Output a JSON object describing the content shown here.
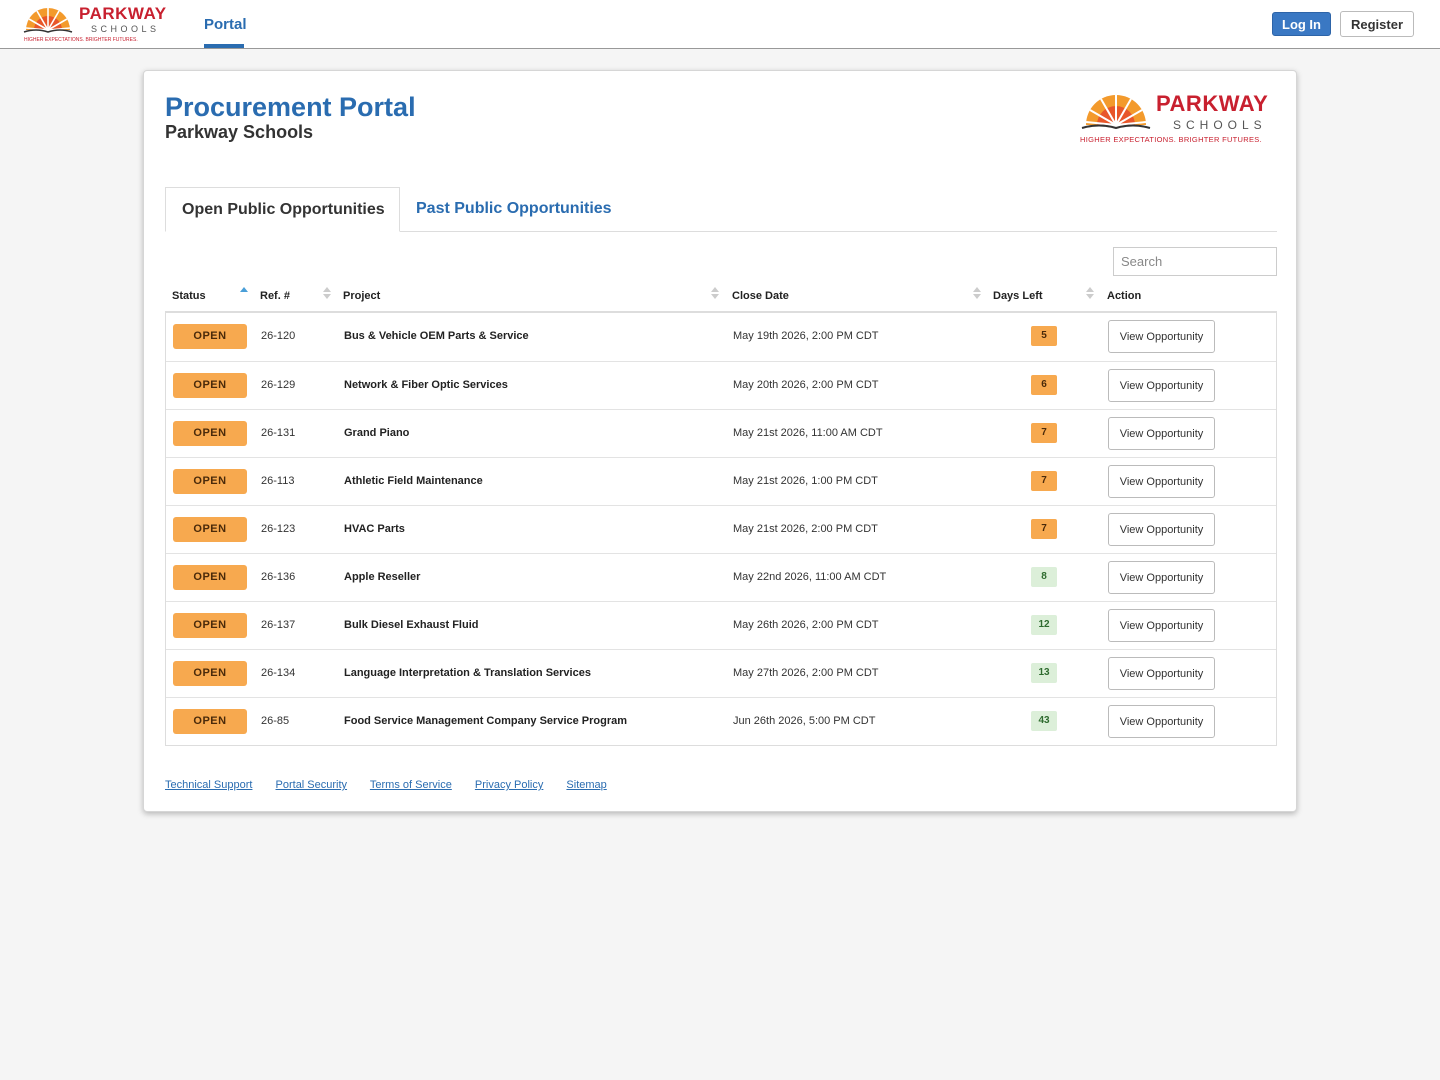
{
  "brand": {
    "name": "PARKWAY",
    "sub": "SCHOOLS",
    "tagline": "HIGHER EXPECTATIONS. BRIGHTER FUTURES.",
    "accent_red": "#c8202f",
    "accent_orange": "#f39a2c"
  },
  "navbar": {
    "portal_label": "Portal",
    "login_label": "Log In",
    "register_label": "Register"
  },
  "header": {
    "title": "Procurement Portal",
    "subtitle": "Parkway Schools"
  },
  "tabs": [
    {
      "label": "Open Public Opportunities",
      "active": true
    },
    {
      "label": "Past Public Opportunities",
      "active": false
    }
  ],
  "search": {
    "placeholder": "Search",
    "value": ""
  },
  "table": {
    "columns": [
      "Status",
      "Ref. #",
      "Project",
      "Close Date",
      "Days Left",
      "Action"
    ],
    "sorted_column": "Status",
    "rows": [
      {
        "status": "OPEN",
        "ref": "26-120",
        "project": "Bus & Vehicle OEM Parts & Service",
        "close_date": "May 19th 2026, 2:00 PM CDT",
        "days_left": "5",
        "days_level": "warn",
        "action": "View Opportunity"
      },
      {
        "status": "OPEN",
        "ref": "26-129",
        "project": "Network & Fiber Optic Services",
        "close_date": "May 20th 2026, 2:00 PM CDT",
        "days_left": "6",
        "days_level": "warn",
        "action": "View Opportunity"
      },
      {
        "status": "OPEN",
        "ref": "26-131",
        "project": "Grand Piano",
        "close_date": "May 21st 2026, 11:00 AM CDT",
        "days_left": "7",
        "days_level": "warn",
        "action": "View Opportunity"
      },
      {
        "status": "OPEN",
        "ref": "26-113",
        "project": "Athletic Field Maintenance",
        "close_date": "May 21st 2026, 1:00 PM CDT",
        "days_left": "7",
        "days_level": "warn",
        "action": "View Opportunity"
      },
      {
        "status": "OPEN",
        "ref": "26-123",
        "project": "HVAC Parts",
        "close_date": "May 21st 2026, 2:00 PM CDT",
        "days_left": "7",
        "days_level": "warn",
        "action": "View Opportunity"
      },
      {
        "status": "OPEN",
        "ref": "26-136",
        "project": "Apple Reseller",
        "close_date": "May 22nd 2026, 11:00 AM CDT",
        "days_left": "8",
        "days_level": "ok",
        "action": "View Opportunity"
      },
      {
        "status": "OPEN",
        "ref": "26-137",
        "project": "Bulk Diesel Exhaust Fluid",
        "close_date": "May 26th 2026, 2:00 PM CDT",
        "days_left": "12",
        "days_level": "ok",
        "action": "View Opportunity"
      },
      {
        "status": "OPEN",
        "ref": "26-134",
        "project": "Language Interpretation & Translation Services",
        "close_date": "May 27th 2026, 2:00 PM CDT",
        "days_left": "13",
        "days_level": "ok",
        "action": "View Opportunity"
      },
      {
        "status": "OPEN",
        "ref": "26-85",
        "project": "Food Service Management Company Service Program",
        "close_date": "Jun 26th 2026, 5:00 PM CDT",
        "days_left": "43",
        "days_level": "ok",
        "action": "View Opportunity"
      }
    ]
  },
  "footer": {
    "links": [
      "Technical Support",
      "Portal Security",
      "Terms of Service",
      "Privacy Policy",
      "Sitemap"
    ]
  }
}
